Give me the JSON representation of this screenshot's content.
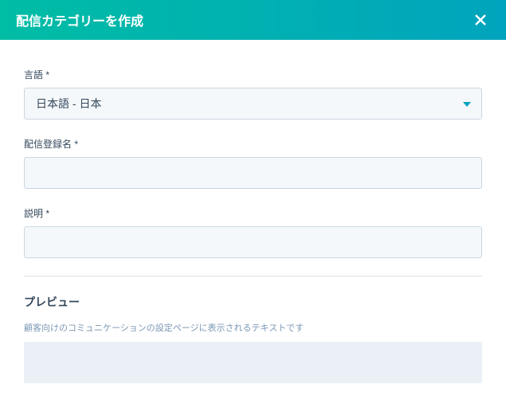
{
  "header": {
    "title": "配信カテゴリーを作成"
  },
  "form": {
    "language_label": "言語 *",
    "language_value": "日本語 - 日本",
    "reg_name_label": "配信登録名 *",
    "reg_name_value": "",
    "description_label": "説明 *",
    "description_value": ""
  },
  "preview": {
    "title": "プレビュー",
    "description": "顧客向けのコミュニケーションの設定ページに表示されるテキストです"
  }
}
